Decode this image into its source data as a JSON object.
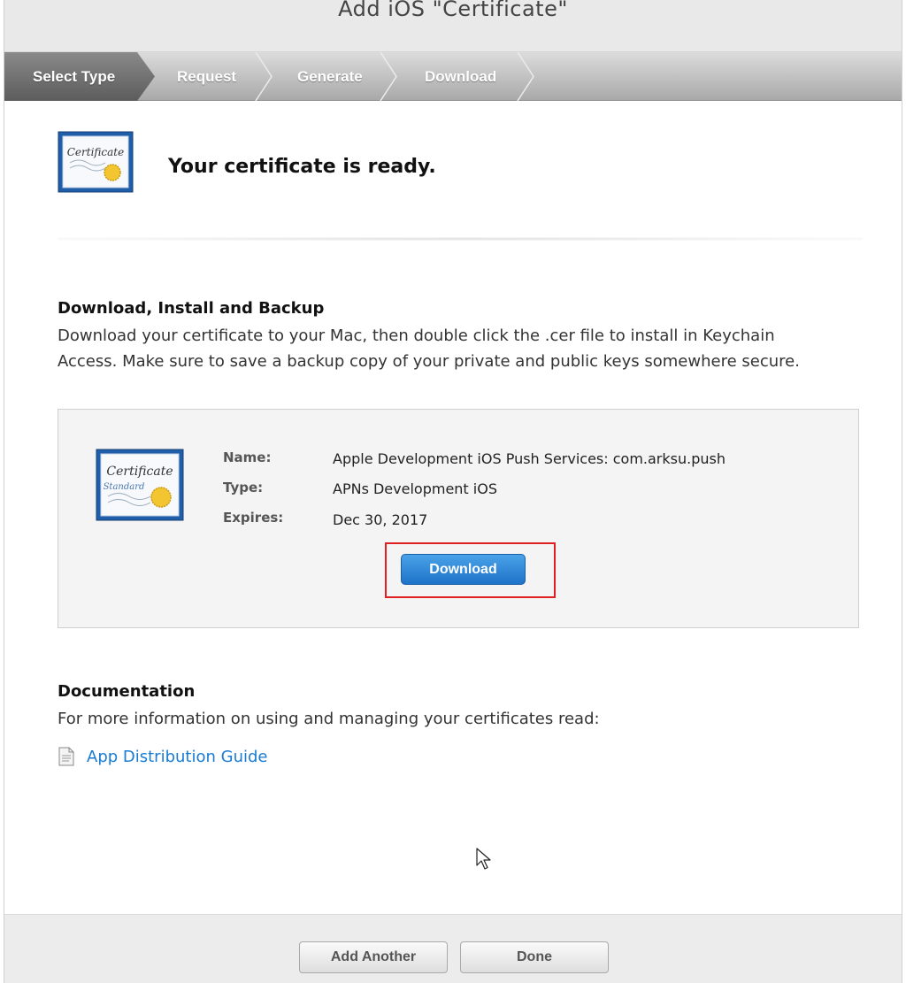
{
  "window": {
    "title": "Add iOS \"Certificate\""
  },
  "steps": [
    {
      "label": "Select Type",
      "active": true
    },
    {
      "label": "Request",
      "active": false
    },
    {
      "label": "Generate",
      "active": false
    },
    {
      "label": "Download",
      "active": false
    }
  ],
  "hero": {
    "icon": "certificate-icon",
    "icon_text": "Certificate",
    "message": "Your certificate is ready."
  },
  "install_section": {
    "title": "Download, Install and Backup",
    "body_line1": "Download your certificate to your Mac, then double click the .cer file to install in Keychain",
    "body_line2": "Access. Make sure to save a backup copy of your private and public keys somewhere secure."
  },
  "certificate": {
    "icon": "certificate-standard-icon",
    "icon_text": "Certificate",
    "icon_subtext": "Standard",
    "fields": [
      {
        "label": "Name:",
        "value": "Apple Development iOS Push Services: com.arksu.push"
      },
      {
        "label": "Type:",
        "value": "APNs Development iOS"
      },
      {
        "label": "Expires:",
        "value": "Dec 30, 2017"
      }
    ],
    "download_label": "Download",
    "highlight_color": "#e02020"
  },
  "documentation": {
    "title": "Documentation",
    "body": "For more information on using and managing your certificates read:",
    "link_icon": "document-icon",
    "link_text": "App Distribution Guide",
    "link_color": "#1a7bd3"
  },
  "footer": {
    "add_another_label": "Add Another",
    "done_label": "Done"
  },
  "colors": {
    "primary_button": "#1e73c8",
    "step_bar": "#a9a9a9"
  }
}
